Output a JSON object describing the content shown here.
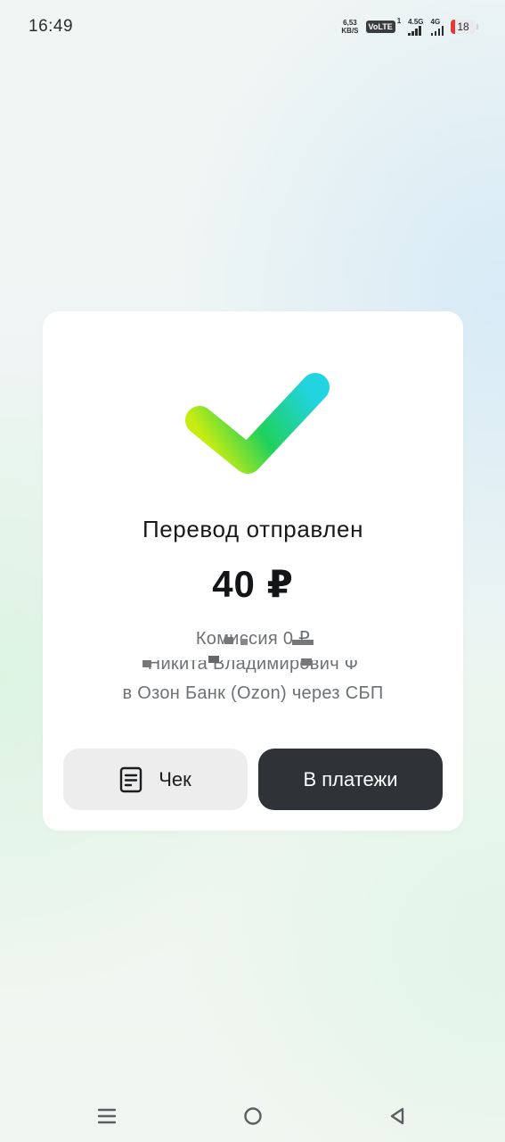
{
  "status_bar": {
    "time": "16:49",
    "net_speed_value": "6,53",
    "net_speed_unit": "KB/S",
    "volte": "VoLTE",
    "volte_sim": "1",
    "signal1_label": "4.5G",
    "signal2_label": "4G",
    "battery_level": "18"
  },
  "card": {
    "icon": "checkmark-icon",
    "title": "Перевод отправлен",
    "amount": "40 ₽",
    "commission": "Комиссия 0 ₽",
    "recipient": "Никита Владимирович Ф",
    "bank": "в Озон Банк (Ozon) через СБП",
    "receipt_button": "Чек",
    "payments_button": "В платежи"
  },
  "colors": {
    "check_gradient_start": "#c6ec13",
    "check_gradient_mid": "#1fd15a",
    "check_gradient_end": "#22d3e0",
    "primary_button": "#2f3337",
    "secondary_button": "#ededee"
  },
  "nav_bar": {
    "icons": [
      "menu-icon",
      "home-circle-icon",
      "back-triangle-icon"
    ]
  }
}
